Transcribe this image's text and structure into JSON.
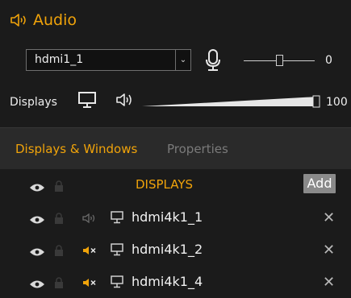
{
  "audio": {
    "title": "Audio",
    "device_select": {
      "value": "hdmi1_1",
      "dropdown_glyph": "⌄"
    },
    "mic_level": 0,
    "mic_value_text": "0",
    "displays_label": "Displays",
    "displays_volume": 100,
    "displays_value_text": "100",
    "icons": [
      "speaker-icon",
      "microphone-icon",
      "monitor-icon"
    ]
  },
  "tabs": [
    {
      "label": "Displays & Windows",
      "active": true
    },
    {
      "label": "Properties",
      "active": false
    }
  ],
  "list": {
    "header_label": "DISPLAYS",
    "add_label": "Add",
    "rows": [
      {
        "name": "hdmi4k1_1",
        "audio_state": "on",
        "remove_glyph": "✕"
      },
      {
        "name": "hdmi4k1_2",
        "audio_state": "muted",
        "remove_glyph": "✕"
      },
      {
        "name": "hdmi4k1_4",
        "audio_state": "muted",
        "remove_glyph": "✕"
      }
    ]
  },
  "colors": {
    "accent": "#f0a30a",
    "background": "#1b1b1b",
    "tabbar": "#2a2a2a",
    "add_button": "#8a8a8a"
  }
}
